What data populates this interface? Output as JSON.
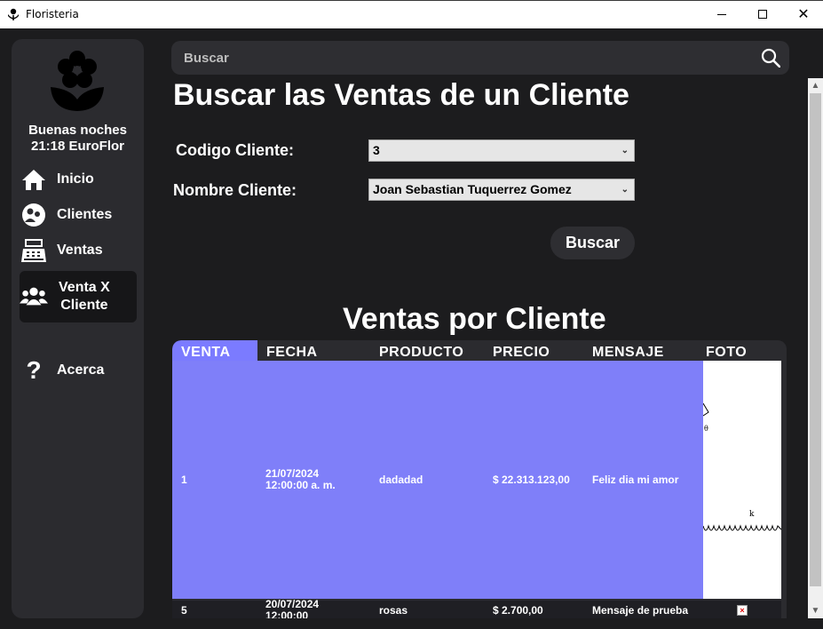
{
  "window": {
    "title": "Floristeria",
    "minimize_icon": "minimize-icon",
    "maximize_icon": "maximize-icon",
    "close_label": "✕"
  },
  "sidebar": {
    "greeting_line1": "Buenas noches",
    "greeting_line2": "21:18 EuroFlor",
    "items": [
      {
        "label": "Inicio",
        "icon": "home-icon"
      },
      {
        "label": "Clientes",
        "icon": "clients-icon"
      },
      {
        "label": "Ventas",
        "icon": "cash-register-icon"
      },
      {
        "label_line1": "Venta X",
        "label_line2": "Cliente",
        "icon": "users-icon",
        "active": true
      },
      {
        "label": "Acerca",
        "icon": "question-icon"
      }
    ]
  },
  "search": {
    "placeholder": "Buscar"
  },
  "main": {
    "title": "Buscar las Ventas de un Cliente",
    "codigo_label": "Codigo Cliente:",
    "codigo_value": "3",
    "nombre_label": "Nombre Cliente:",
    "nombre_value": "Joan Sebastian Tuquerrez Gomez",
    "buscar_button": "Buscar",
    "section_title": "Ventas por Cliente"
  },
  "table": {
    "columns": [
      "VENTA",
      "FECHA",
      "PRODUCTO",
      "PRECIO",
      "MENSAJE",
      "FOTO"
    ],
    "rows": [
      {
        "venta": "1",
        "fecha_line1": "21/07/2024",
        "fecha_line2": "12:00:00 a. m.",
        "producto": "dadadad",
        "precio": "$ 22.313.123,00",
        "mensaje": "Feliz dia mi amor"
      },
      {
        "venta": "5",
        "fecha_line1": "20/07/2024",
        "fecha_line2": "12:00:00",
        "producto": "rosas",
        "precio": "$ 2.700,00",
        "mensaje": "Mensaje de prueba"
      }
    ]
  },
  "colors": {
    "background": "#1c1c1e",
    "panel": "#2b2b2f",
    "selected_row": "#7f7ff9"
  }
}
